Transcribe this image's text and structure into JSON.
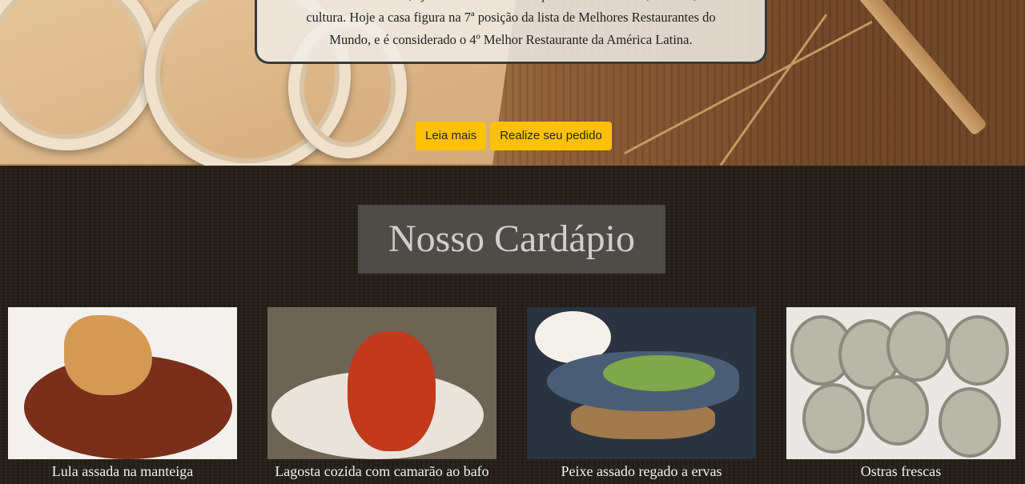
{
  "hero": {
    "text_line_1": "transformando o bairro, ajudando a torná-lo um polo de criatividade, turismo, lazer e",
    "text_line_2": "cultura. Hoje a casa figura na 7ª posição da lista de Melhores Restaurantes do",
    "text_line_3": "Mundo, e é considerado o 4º Melhor Restaurante da América Latina.",
    "read_more_label": "Leia mais",
    "order_label": "Realize seu pedido"
  },
  "menu": {
    "title": "Nosso Cardápio",
    "items": [
      {
        "name": "Lula assada na manteiga"
      },
      {
        "name": "Lagosta cozida com camarão ao bafo"
      },
      {
        "name": "Peixe assado regado a ervas"
      },
      {
        "name": "Ostras frescas"
      }
    ]
  },
  "colors": {
    "button": "#ffc107",
    "menu_background": "#241f17",
    "title_box": "#5a5854"
  }
}
